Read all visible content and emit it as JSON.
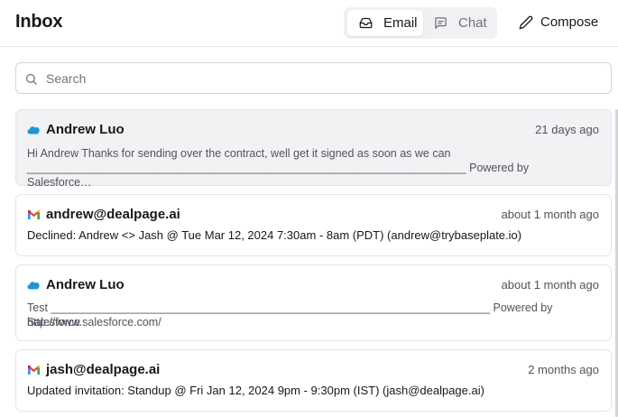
{
  "header": {
    "title": "Inbox",
    "tabs": [
      {
        "label": "Email",
        "icon": "inbox-icon",
        "active": true
      },
      {
        "label": "Chat",
        "icon": "chat-icon",
        "active": false
      }
    ],
    "compose_label": "Compose"
  },
  "search": {
    "placeholder": "Search"
  },
  "messages": [
    {
      "source": "salesforce",
      "source_icon": "salesforce-cloud-icon",
      "sender": "Andrew Luo",
      "time": "21 days ago",
      "preview_line1": "Hi Andrew Thanks for sending over the contract, well get it signed as soon as we can",
      "preview_line2": "______________________________________________________________________ Powered by Salesforce…",
      "selected": true
    },
    {
      "source": "gmail",
      "source_icon": "gmail-icon",
      "sender": "andrew@dealpage.ai",
      "time": "about 1 month ago",
      "subject": "Declined: Andrew <> Jash @ Tue Mar 12, 2024 7:30am - 8am (PDT) (andrew@trybaseplate.io)"
    },
    {
      "source": "salesforce",
      "source_icon": "salesforce-cloud-icon",
      "sender": "Andrew Luo",
      "time": "about 1 month ago",
      "preview_line1": "Test ______________________________________________________________________ Powered by Salesforce",
      "preview_line2": "http://www.salesforce.com/"
    },
    {
      "source": "gmail",
      "source_icon": "gmail-icon",
      "sender": "jash@dealpage.ai",
      "time": "2 months ago",
      "subject": "Updated invitation: Standup @ Fri Jan 12, 2024 9pm - 9:30pm (IST) (jash@dealpage.ai)"
    }
  ],
  "colors": {
    "salesforce": "#1B96D6",
    "gmail_red": "#EA4335",
    "gmail_blue": "#4285F4",
    "gmail_green": "#34A853",
    "gmail_yellow": "#FBBC05",
    "selected_bg": "#F1F2F4"
  }
}
